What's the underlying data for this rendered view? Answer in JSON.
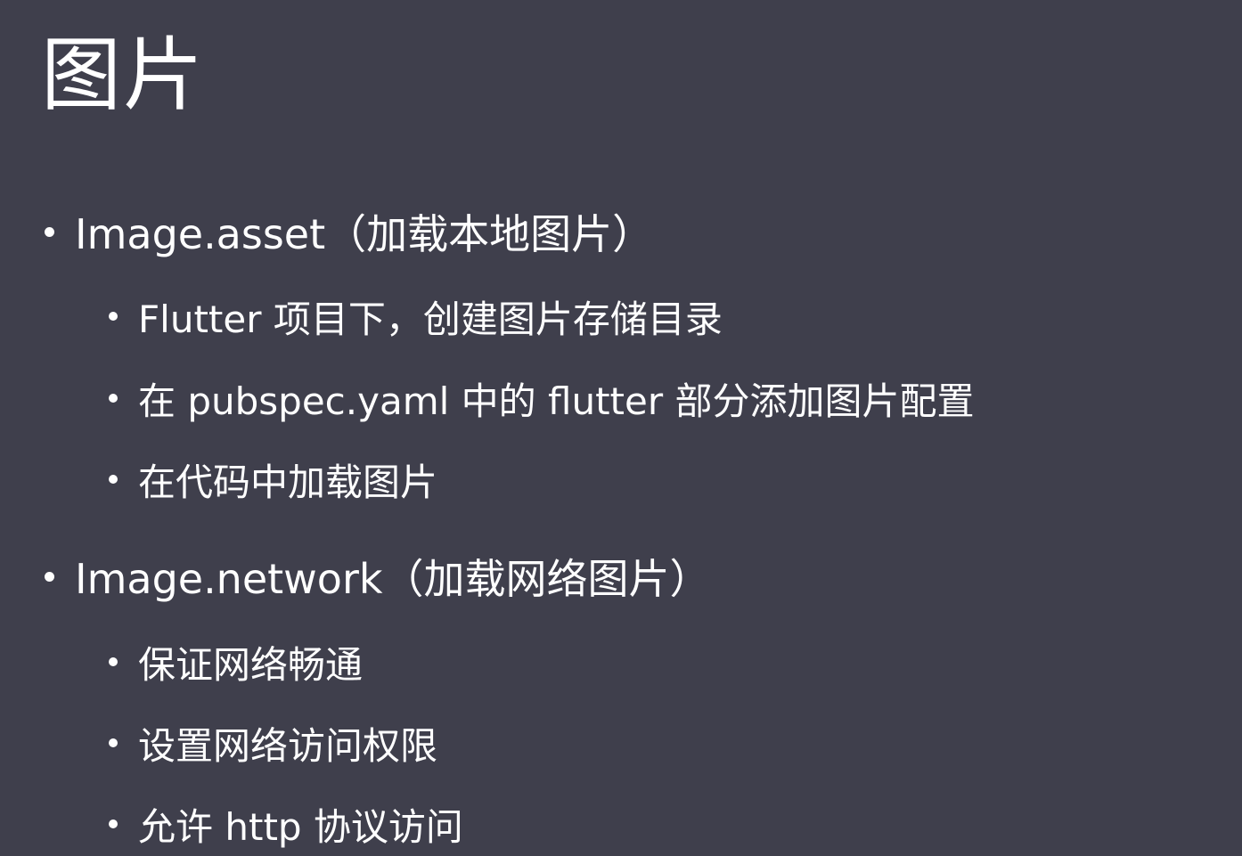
{
  "slide": {
    "title": "图片",
    "sections": [
      {
        "heading": "Image.asset（加载本地图片）",
        "items": [
          "Flutter 项目下，创建图片存储目录",
          "在 pubspec.yaml 中的 flutter 部分添加图片配置",
          "在代码中加载图片"
        ]
      },
      {
        "heading": "Image.network（加载网络图片）",
        "items": [
          "保证网络畅通",
          "设置网络访问权限",
          "允许 http 协议访问"
        ]
      }
    ]
  },
  "colors": {
    "background": "#3f3f4c",
    "text": "#ffffff"
  },
  "icons": {
    "bullet": "bullet-dot"
  }
}
